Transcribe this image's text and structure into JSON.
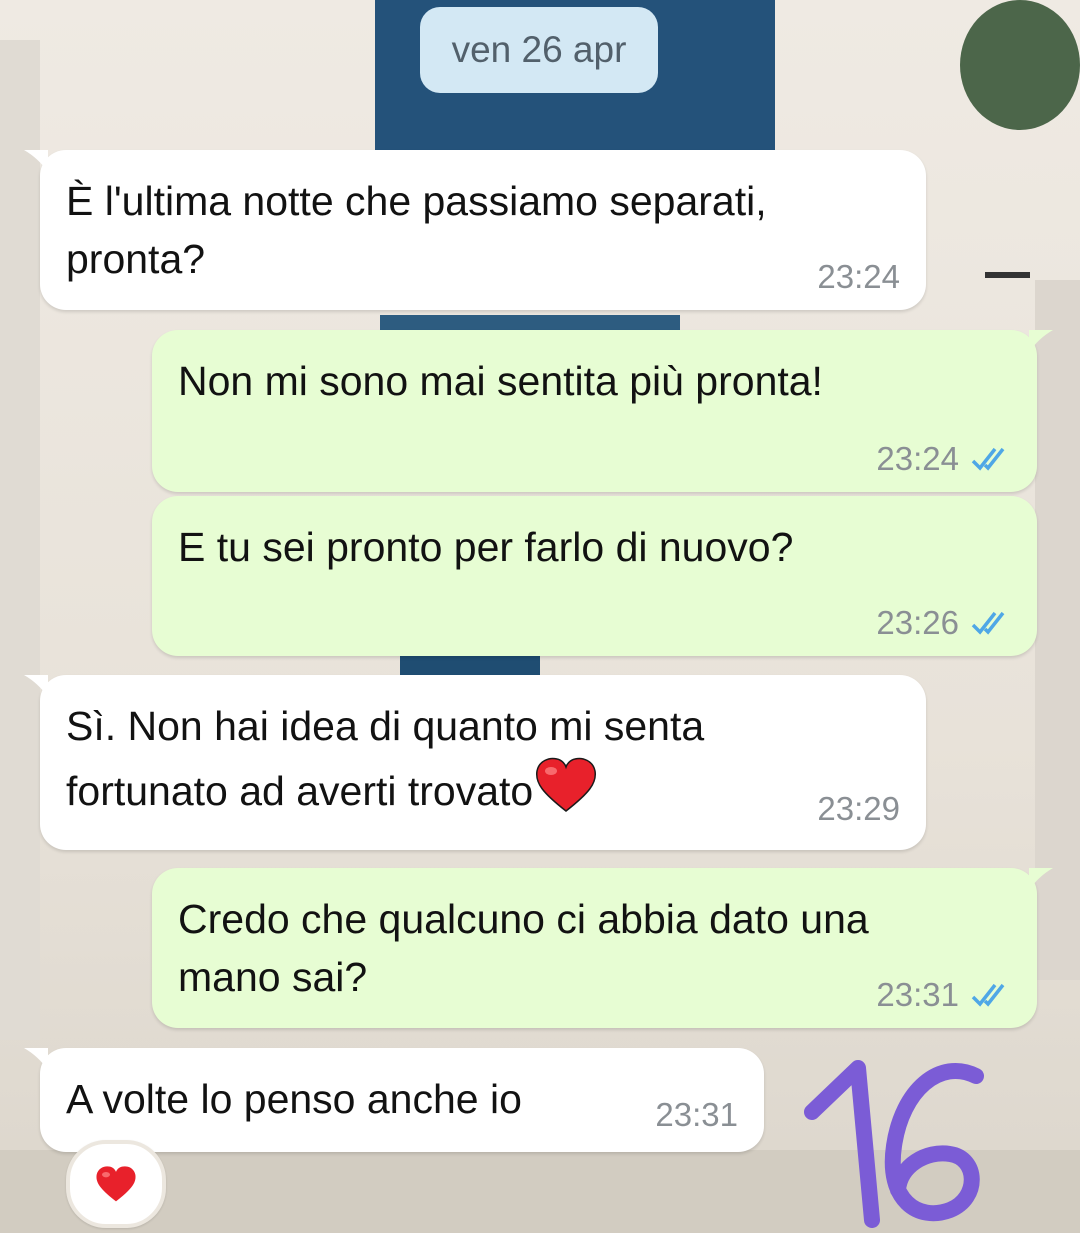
{
  "chat": {
    "date_label": "ven 26 apr",
    "messages": [
      {
        "direction": "incoming",
        "text": "È l'ultima notte che passiamo separati, pronta?",
        "time": "23:24"
      },
      {
        "direction": "outgoing",
        "text": "Non mi sono mai sentita più pronta!",
        "time": "23:24",
        "status": "read"
      },
      {
        "direction": "outgoing",
        "text": "E tu sei pronto per farlo di nuovo?",
        "time": "23:26",
        "status": "read"
      },
      {
        "direction": "incoming",
        "text_line1": "Sì. Non hai idea di quanto mi senta",
        "text_line2": "fortunato ad averti trovato",
        "emoji": "heart",
        "time": "23:29"
      },
      {
        "direction": "outgoing",
        "text": "Credo che qualcuno ci abbia dato una mano sai?",
        "time": "23:31",
        "status": "read"
      },
      {
        "direction": "incoming",
        "text": "A volte lo penso anche io",
        "time": "23:31",
        "reaction": "heart"
      }
    ]
  },
  "overlay": {
    "handwritten_number": "16",
    "color": "#7b5cd6"
  },
  "colors": {
    "incoming_bubble": "#ffffff",
    "outgoing_bubble": "#e7fdd3",
    "read_ticks": "#4fa7e6",
    "date_chip": "#d3e8f4"
  }
}
